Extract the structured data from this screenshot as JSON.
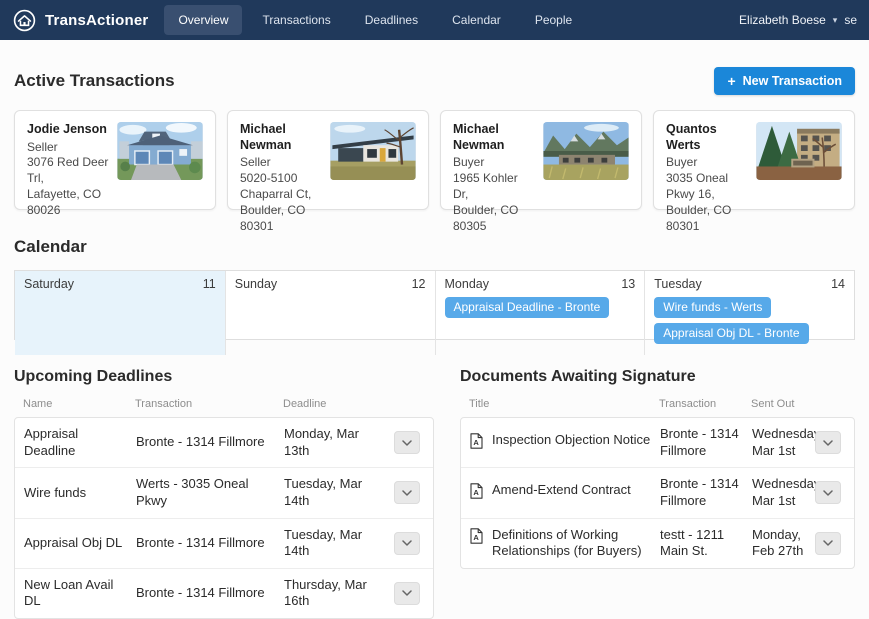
{
  "navbar": {
    "brand": "TransActioner",
    "items": [
      {
        "label": "Overview",
        "active": true
      },
      {
        "label": "Transactions",
        "active": false
      },
      {
        "label": "Deadlines",
        "active": false
      },
      {
        "label": "Calendar",
        "active": false
      },
      {
        "label": "People",
        "active": false
      }
    ],
    "user_name": "Elizabeth Boese",
    "truncated_right_text": "se"
  },
  "active_transactions": {
    "title": "Active Transactions",
    "new_button_label": "New Transaction",
    "plus_icon": "+",
    "cards": [
      {
        "name": "Jodie Jenson",
        "role": "Seller",
        "address_lines": [
          "3076 Red Deer Trl,",
          "Lafayette, CO 80026"
        ],
        "photo": "blue-two-story-house"
      },
      {
        "name": "Michael Newman",
        "role": "Seller",
        "address_lines": [
          "5020-5100",
          "Chaparral Ct,",
          "Boulder, CO 80301"
        ],
        "photo": "modern-ranch-house"
      },
      {
        "name": "Michael Newman",
        "role": "Buyer",
        "address_lines": [
          "1965 Kohler Dr,",
          "Boulder, CO 80305"
        ],
        "photo": "mountain-house"
      },
      {
        "name": "Quantos Werts",
        "role": "Buyer",
        "address_lines": [
          "3035 Oneal Pkwy 16,",
          "Boulder, CO 80301"
        ],
        "photo": "condo-building"
      }
    ]
  },
  "calendar": {
    "title": "Calendar",
    "days": [
      {
        "name": "Saturday",
        "number": "11",
        "today": true,
        "events": []
      },
      {
        "name": "Sunday",
        "number": "12",
        "today": false,
        "events": []
      },
      {
        "name": "Monday",
        "number": "13",
        "today": false,
        "events": [
          "Appraisal Deadline - Bronte"
        ]
      },
      {
        "name": "Tuesday",
        "number": "14",
        "today": false,
        "events": [
          "Wire funds - Werts",
          "Appraisal Obj DL - Bronte"
        ]
      }
    ]
  },
  "deadlines": {
    "title": "Upcoming Deadlines",
    "columns": [
      "Name",
      "Transaction",
      "Deadline"
    ],
    "rows": [
      {
        "name": "Appraisal Deadline",
        "transaction": "Bronte - 1314 Fillmore",
        "deadline": "Monday, Mar 13th"
      },
      {
        "name": "Wire funds",
        "transaction": "Werts - 3035 Oneal Pkwy",
        "deadline": "Tuesday, Mar 14th"
      },
      {
        "name": "Appraisal Obj DL",
        "transaction": "Bronte - 1314 Fillmore",
        "deadline": "Tuesday, Mar 14th"
      },
      {
        "name": "New Loan Avail DL",
        "transaction": "Bronte - 1314 Fillmore",
        "deadline": "Thursday, Mar 16th"
      }
    ]
  },
  "documents": {
    "title": "Documents Awaiting Signature",
    "columns": [
      "Title",
      "Transaction",
      "Sent Out"
    ],
    "rows": [
      {
        "title": "Inspection Objection Notice",
        "transaction": "Bronte - 1314 Fillmore",
        "sent_out": "Wednesday, Mar 1st"
      },
      {
        "title": "Amend-Extend Contract",
        "transaction": "Bronte - 1314 Fillmore",
        "sent_out": "Wednesday, Mar 1st"
      },
      {
        "title": "Definitions of Working Relationships (for Buyers)",
        "transaction": "testt - 1211 Main St.",
        "sent_out": "Monday, Feb 27th"
      }
    ]
  },
  "colors": {
    "navbar": "#20395b",
    "nav_active": "#394f70",
    "accent": "#1b87d9",
    "event": "#57a9e9",
    "today": "#e7f3fb"
  }
}
